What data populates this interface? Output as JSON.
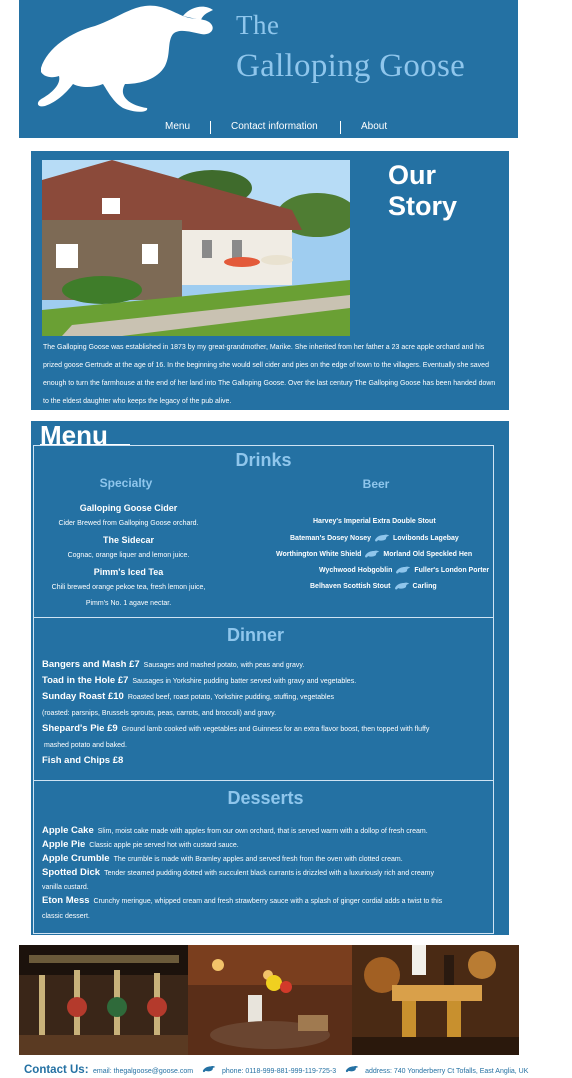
{
  "header": {
    "title_line1": "The",
    "title_line2": "Galloping Goose",
    "logo_icon": "galloping-goose-icon"
  },
  "nav": [
    {
      "label": "Menu"
    },
    {
      "label": "Contact information"
    },
    {
      "label": "About"
    }
  ],
  "story": {
    "title": "Our Story",
    "text": "The Galloping Goose was established in 1873 by my great-grandmother, Marike. She inherited from her father a 23 acre apple orchard and his prized goose Gertrude at the age of 16. In the beginning she would sell cider and pies on the edge of town to the villagers. Eventually she saved enough to turn the farmhouse at the end of her land into The Galloping Goose. Over the last century The Galloping Goose has been handed down to the eldest daughter who keeps the legacy of the pub alive."
  },
  "menu": {
    "title": "Menu",
    "drinks": {
      "title": "Drinks",
      "specialty": {
        "title": "Specialty",
        "items": [
          {
            "name": "Galloping Goose Cider",
            "desc": "Cider Brewed from Galloping Goose orchard."
          },
          {
            "name": "The Sidecar",
            "desc": "Cognac, orange liquer and lemon juice."
          },
          {
            "name": "Pimm's Iced Tea",
            "desc": "Chili brewed orange pekoe tea, fresh lemon juice,",
            "desc2": "Pimm's No. 1 agave nectar."
          }
        ]
      },
      "beer": {
        "title": "Beer",
        "rows": [
          {
            "left": "Harvey's Imperial Extra Double Stout",
            "right": ""
          },
          {
            "left": "Bateman's Dosey Nosey",
            "right": "Lovibonds Lagebay"
          },
          {
            "left": "Worthington White Shield",
            "right": "Morland Old Speckled Hen"
          },
          {
            "left": "Wychwood Hobgoblin",
            "right": "Fuller's London Porter"
          },
          {
            "left": "Belhaven Scottish Stout",
            "right": "Carling"
          }
        ]
      }
    },
    "dinner": {
      "title": "Dinner",
      "items": [
        {
          "name": "Bangers and Mash £7",
          "desc": "Sausages and mashed potato, with peas and gravy."
        },
        {
          "name": "Toad in the Hole £7",
          "desc": "Sausages in Yorkshire pudding batter served with gravy and vegetables."
        },
        {
          "name": "Sunday Roast £10",
          "desc": "Roasted beef, roast potato, Yorkshire pudding, stuffing, vegetables",
          "desc2": "(roasted: parsnips, Brussels sprouts, peas, carrots, and broccoli) and gravy."
        },
        {
          "name": "Shepard's Pie £9",
          "desc": "Ground lamb cooked with vegetables and Guinness for an extra flavor boost, then topped with fluffy",
          "desc2": "mashed potato and baked."
        },
        {
          "name": "Fish and Chips £8",
          "desc": ""
        }
      ]
    },
    "desserts": {
      "title": "Desserts",
      "items": [
        {
          "name": "Apple Cake",
          "desc": "Slim, moist cake made with apples from our own orchard, that is served warm with a dollop of fresh cream."
        },
        {
          "name": "Apple Pie",
          "desc": "Classic apple pie served hot with custard sauce."
        },
        {
          "name": "Apple Crumble",
          "desc": "The crumble is made with Bramley apples and served fresh from the oven with clotted cream."
        },
        {
          "name": "Spotted Dick",
          "desc": "Tender steamed pudding dotted with succulent black currants is drizzled with a luxuriously rich and creamy",
          "desc2": "vanilla custard."
        },
        {
          "name": "Eton Mess",
          "desc": "Crunchy meringue, whipped cream and fresh strawberry sauce with a splash of ginger cordial adds a twist to this",
          "desc2": "classic dessert."
        }
      ]
    }
  },
  "contact": {
    "title": "Contact Us:",
    "email": "email: thegalgoose@goose.com",
    "phone": "phone: 0118-999-881-999-119-725-3",
    "address": "address: 740 Yonderberry Ct Tofalls, East Anglia, UK"
  },
  "colors": {
    "brand_blue": "#2471a3",
    "accent_light_blue": "#8fc6ec"
  }
}
